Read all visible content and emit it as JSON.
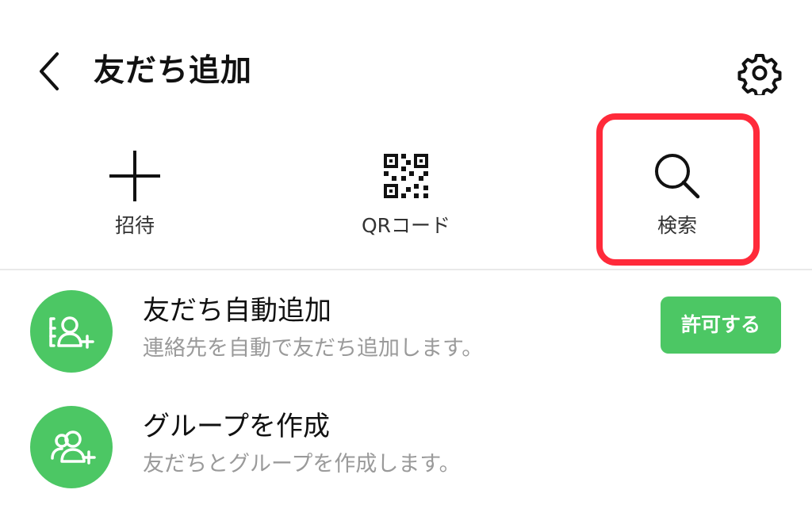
{
  "header": {
    "title": "友だち追加",
    "back_icon": "chevron-left-icon",
    "settings_icon": "gear-icon"
  },
  "actions": [
    {
      "label": "招待",
      "icon": "plus-icon"
    },
    {
      "label": "QRコード",
      "icon": "qr-code-icon"
    },
    {
      "label": "検索",
      "icon": "search-icon"
    }
  ],
  "list": [
    {
      "title": "友だち自動追加",
      "subtitle": "連絡先を自動で友だち追加します。",
      "icon": "contact-add-icon",
      "button_label": "許可する"
    },
    {
      "title": "グループを作成",
      "subtitle": "友だちとグループを作成します。",
      "icon": "group-add-icon"
    }
  ],
  "colors": {
    "accent_green": "#4cc764",
    "highlight_red": "#ff2a3a"
  }
}
